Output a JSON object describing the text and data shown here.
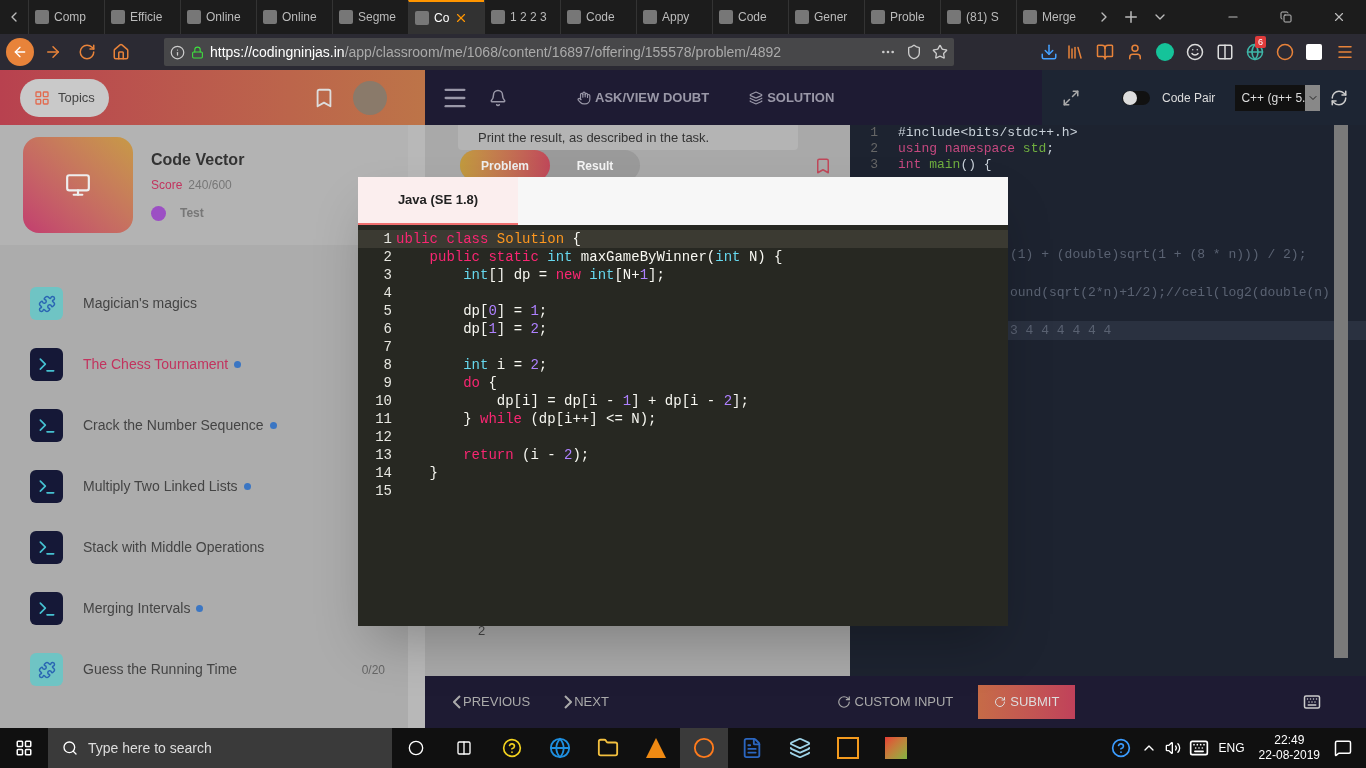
{
  "browser": {
    "tabs": [
      {
        "title": "Comp",
        "selected": false
      },
      {
        "title": "Efficie",
        "selected": false
      },
      {
        "title": "Online",
        "selected": false
      },
      {
        "title": "Online",
        "selected": false
      },
      {
        "title": "Segme",
        "selected": false
      },
      {
        "title": "Co",
        "selected": true
      },
      {
        "title": "1 2 2 3",
        "selected": false
      },
      {
        "title": "Code",
        "selected": false
      },
      {
        "title": "Appy",
        "selected": false
      },
      {
        "title": "Code",
        "selected": false
      },
      {
        "title": "Gener",
        "selected": false
      },
      {
        "title": "Proble",
        "selected": false
      },
      {
        "title": "(81) S",
        "selected": false
      },
      {
        "title": "Merge",
        "selected": false
      }
    ],
    "url": {
      "host": "https://codingninjas.in",
      "path": "/app/classroom/me/1068/content/16897/offering/155578/problem/4892"
    },
    "badge": "6"
  },
  "sidebar": {
    "topics_button": "Topics",
    "course": {
      "title": "Code Vector",
      "score_label": "Score",
      "score": "240/600",
      "type": "Test"
    },
    "items": [
      {
        "title": "Magician's magics",
        "kind": "puzzle",
        "selected": false,
        "dot": false
      },
      {
        "title": "The Chess Tournament",
        "kind": "code",
        "selected": true,
        "dot": true
      },
      {
        "title": "Crack the Number Sequence",
        "kind": "code",
        "selected": false,
        "dot": true
      },
      {
        "title": "Multiply Two Linked Lists",
        "kind": "code",
        "selected": false,
        "dot": true
      },
      {
        "title": "Stack with Middle Operations",
        "kind": "code",
        "selected": false,
        "dot": false
      },
      {
        "title": "Merging Intervals",
        "kind": "code",
        "selected": false,
        "dot": true
      },
      {
        "title": "Guess the Running Time",
        "kind": "puzzle",
        "selected": false,
        "dot": false,
        "progress": "0/20"
      }
    ]
  },
  "toolbar": {
    "doubt": "ASK/VIEW DOUBT",
    "solution": "SOLUTION",
    "code_pair": {
      "label": "Code Pair",
      "on": false
    },
    "language": "C++ (g++ 5."
  },
  "problem": {
    "text": "Print the result, as described in the task.",
    "tabs": [
      {
        "label": "Problem",
        "selected": true
      },
      {
        "label": "Result",
        "selected": false
      }
    ],
    "footer_value": "2"
  },
  "editor": {
    "lines": [
      {
        "number": "1",
        "tokens": [
          {
            "kind": "plain",
            "text": "#include<bits/stdc++.h>"
          }
        ]
      },
      {
        "number": "2",
        "tokens": [
          {
            "kind": "keyword",
            "text": "using namespace"
          },
          {
            "kind": "name",
            "text": " std"
          },
          {
            "kind": "plain",
            "text": ";"
          }
        ]
      },
      {
        "number": "3",
        "tokens": [
          {
            "kind": "keyword",
            "text": "int"
          },
          {
            "kind": "name",
            "text": " main"
          },
          {
            "kind": "plain",
            "text": "() {"
          }
        ]
      }
    ],
    "fragments": [
      "(1) + (double)sqrt(1 + (8 * n))) / 2);",
      "ound(sqrt(2*n)+1/2);//ceil(log2(double(n)",
      "3 4 4 4 4 4 4"
    ]
  },
  "modal": {
    "tabs": [
      {
        "label": "Java (SE 1.8)",
        "selected": true
      }
    ],
    "lines": [
      {
        "number": "1",
        "tokens": [
          {
            "kind": "keyword",
            "text": "ublic class"
          },
          {
            "kind": "class",
            "text": " Solution"
          },
          {
            "kind": "plain",
            "text": " {"
          }
        ]
      },
      {
        "number": "2",
        "tokens": [
          {
            "kind": "keyword",
            "text": "    public static"
          },
          {
            "kind": "type",
            "text": " int"
          },
          {
            "kind": "plain",
            "text": " maxGameByWinner("
          },
          {
            "kind": "type",
            "text": "int"
          },
          {
            "kind": "plain",
            "text": " N) {"
          }
        ]
      },
      {
        "number": "3",
        "tokens": [
          {
            "kind": "type",
            "text": "        int"
          },
          {
            "kind": "plain",
            "text": "[] dp = "
          },
          {
            "kind": "keyword",
            "text": "new"
          },
          {
            "kind": "type",
            "text": " int"
          },
          {
            "kind": "plain",
            "text": "[N+"
          },
          {
            "kind": "number",
            "text": "1"
          },
          {
            "kind": "plain",
            "text": "];"
          }
        ]
      },
      {
        "number": "4"
      },
      {
        "number": "5",
        "tokens": [
          {
            "kind": "plain",
            "text": "        dp["
          },
          {
            "kind": "number",
            "text": "0"
          },
          {
            "kind": "plain",
            "text": "] = "
          },
          {
            "kind": "number",
            "text": "1"
          },
          {
            "kind": "plain",
            "text": ";"
          }
        ]
      },
      {
        "number": "6",
        "tokens": [
          {
            "kind": "plain",
            "text": "        dp["
          },
          {
            "kind": "number",
            "text": "1"
          },
          {
            "kind": "plain",
            "text": "] = "
          },
          {
            "kind": "number",
            "text": "2"
          },
          {
            "kind": "plain",
            "text": ";"
          }
        ]
      },
      {
        "number": "7"
      },
      {
        "number": "8",
        "tokens": [
          {
            "kind": "type",
            "text": "        int"
          },
          {
            "kind": "plain",
            "text": " i = "
          },
          {
            "kind": "number",
            "text": "2"
          },
          {
            "kind": "plain",
            "text": ";"
          }
        ]
      },
      {
        "number": "9",
        "tokens": [
          {
            "kind": "keyword",
            "text": "        do"
          },
          {
            "kind": "plain",
            "text": " {"
          }
        ]
      },
      {
        "number": "10",
        "tokens": [
          {
            "kind": "plain",
            "text": "            dp[i] = dp[i - "
          },
          {
            "kind": "number",
            "text": "1"
          },
          {
            "kind": "plain",
            "text": "] + dp[i - "
          },
          {
            "kind": "number",
            "text": "2"
          },
          {
            "kind": "plain",
            "text": "];"
          }
        ]
      },
      {
        "number": "11",
        "tokens": [
          {
            "kind": "plain",
            "text": "        } "
          },
          {
            "kind": "keyword",
            "text": "while"
          },
          {
            "kind": "plain",
            "text": " (dp[i++] <= N);"
          }
        ]
      },
      {
        "number": "12"
      },
      {
        "number": "13",
        "tokens": [
          {
            "kind": "keyword",
            "text": "        return"
          },
          {
            "kind": "plain",
            "text": " (i - "
          },
          {
            "kind": "number",
            "text": "2"
          },
          {
            "kind": "plain",
            "text": ");"
          }
        ]
      },
      {
        "number": "14",
        "tokens": [
          {
            "kind": "plain",
            "text": "    }"
          }
        ]
      },
      {
        "number": "15"
      }
    ]
  },
  "footer": {
    "previous": "PREVIOUS",
    "next": "NEXT",
    "custom_input": "CUSTOM INPUT",
    "submit": "SUBMIT"
  },
  "taskbar": {
    "search_placeholder": "Type here to search",
    "language": "ENG",
    "time": "22:49",
    "date": "22-08-2019"
  }
}
